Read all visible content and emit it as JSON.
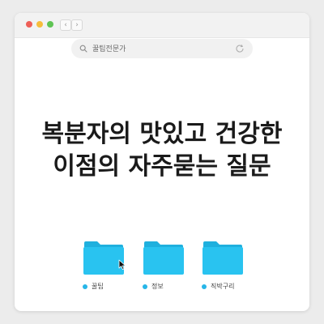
{
  "browser": {
    "back_icon": "chevron-left-icon",
    "back_glyph": "‹",
    "forward_icon": "chevron-right-icon",
    "forward_glyph": "›",
    "search_text": "꿀팁전문가",
    "search_icon": "search-icon",
    "reload_icon": "reload-icon"
  },
  "headline": {
    "line1": "복분자의 맛있고 건강한",
    "line2": "이점의 자주묻는 질문"
  },
  "folders": [
    {
      "label": "꿀팁",
      "icon": "folder-icon"
    },
    {
      "label": "정보",
      "icon": "folder-icon"
    },
    {
      "label": "직박구리",
      "icon": "folder-icon"
    }
  ],
  "colors": {
    "folder": "#29c3f0",
    "folder_tab": "#1fb0de",
    "dot": "#27b6e8",
    "close": "#ee5f57",
    "minimize": "#f6bd3b",
    "maximize": "#5fc454"
  }
}
